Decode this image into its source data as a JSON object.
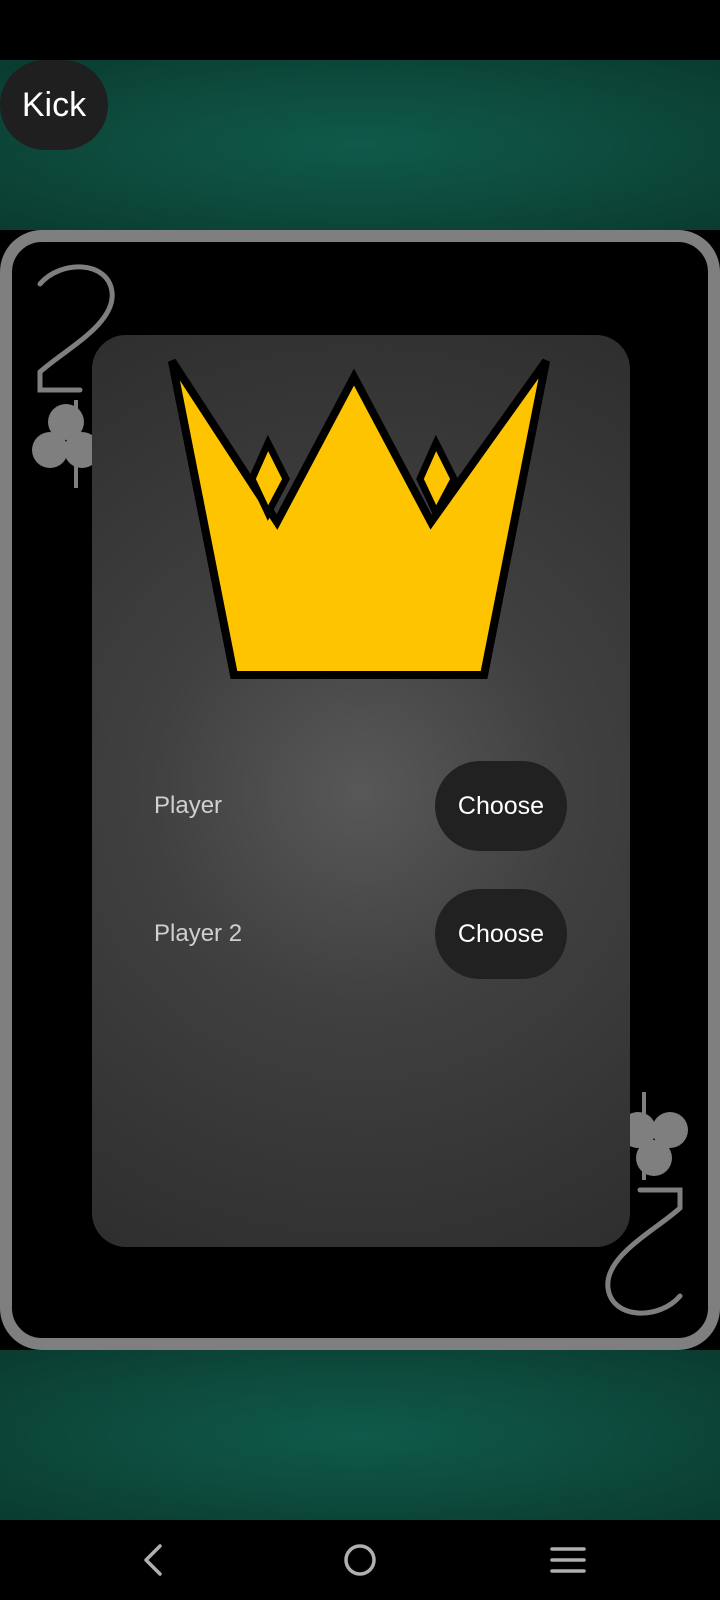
{
  "top_bar": {
    "kick_label": "Kick"
  },
  "card": {
    "rank": "2",
    "suit": "clubs-icon",
    "colors": {
      "border": "#7f7f7f",
      "face": "#000000",
      "suit": "#7f7f7f"
    }
  },
  "dialog": {
    "icon": "crown-icon",
    "crown_color": "#FFC400",
    "players": [
      {
        "name": "Player",
        "button_label": "Choose"
      },
      {
        "name": "Player 2",
        "button_label": "Choose"
      }
    ]
  },
  "navigation": {
    "back_icon": "back-icon",
    "home_icon": "home-icon",
    "recents_icon": "recents-icon"
  },
  "colors": {
    "felt": "#0d4a3c",
    "button_bg": "#212121"
  }
}
